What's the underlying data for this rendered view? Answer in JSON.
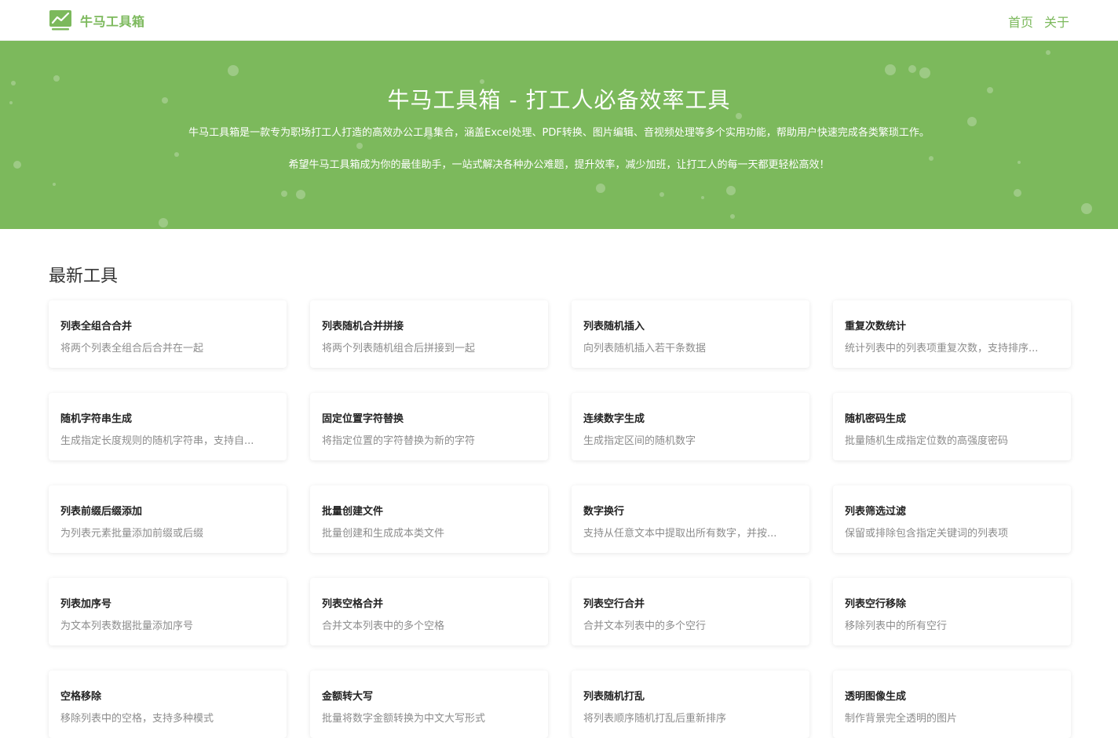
{
  "brand": {
    "name": "牛马工具箱",
    "icon": "chart-trend-icon",
    "color": "#7cb95c"
  },
  "nav": {
    "items": [
      {
        "label": "首页"
      },
      {
        "label": "关于"
      }
    ]
  },
  "hero": {
    "title": "牛马工具箱 - 打工人必备效率工具",
    "description": "牛马工具箱是一款专为职场打工人打造的高效办公工具集合，涵盖Excel处理、PDF转换、图片编辑、音视频处理等多个实用功能，帮助用户快速完成各类繁琐工作。",
    "slogan": "希望牛马工具箱成为你的最佳助手，一站式解决各种办公难题，提升效率，减少加班，让打工人的每一天都更轻松高效！",
    "background": "#7cb95c"
  },
  "latest": {
    "heading": "最新工具",
    "tools": [
      {
        "title": "列表全组合合并",
        "desc": "将两个列表全组合后合并在一起"
      },
      {
        "title": "列表随机合并拼接",
        "desc": "将两个列表随机组合后拼接到一起"
      },
      {
        "title": "列表随机插入",
        "desc": "向列表随机插入若干条数据"
      },
      {
        "title": "重复次数统计",
        "desc": "统计列表中的列表项重复次数，支持排序..."
      },
      {
        "title": "随机字符串生成",
        "desc": "生成指定长度规则的随机字符串，支持自..."
      },
      {
        "title": "固定位置字符替换",
        "desc": "将指定位置的字符替换为新的字符"
      },
      {
        "title": "连续数字生成",
        "desc": "生成指定区间的随机数字"
      },
      {
        "title": "随机密码生成",
        "desc": "批量随机生成指定位数的高强度密码"
      },
      {
        "title": "列表前缀后缀添加",
        "desc": "为列表元素批量添加前缀或后缀"
      },
      {
        "title": "批量创建文件",
        "desc": "批量创建和生成成本类文件"
      },
      {
        "title": "数字换行",
        "desc": "支持从任意文本中提取出所有数字，并按..."
      },
      {
        "title": "列表筛选过滤",
        "desc": "保留或排除包含指定关键词的列表项"
      },
      {
        "title": "列表加序号",
        "desc": "为文本列表数据批量添加序号"
      },
      {
        "title": "列表空格合并",
        "desc": "合并文本列表中的多个空格"
      },
      {
        "title": "列表空行合并",
        "desc": "合并文本列表中的多个空行"
      },
      {
        "title": "列表空行移除",
        "desc": "移除列表中的所有空行"
      },
      {
        "title": "空格移除",
        "desc": "移除列表中的空格，支持多种模式"
      },
      {
        "title": "金额转大写",
        "desc": "批量将数字金额转换为中文大写形式"
      },
      {
        "title": "列表随机打乱",
        "desc": "将列表顺序随机打乱后重新排序"
      },
      {
        "title": "透明图像生成",
        "desc": "制作背景完全透明的图片"
      }
    ]
  }
}
